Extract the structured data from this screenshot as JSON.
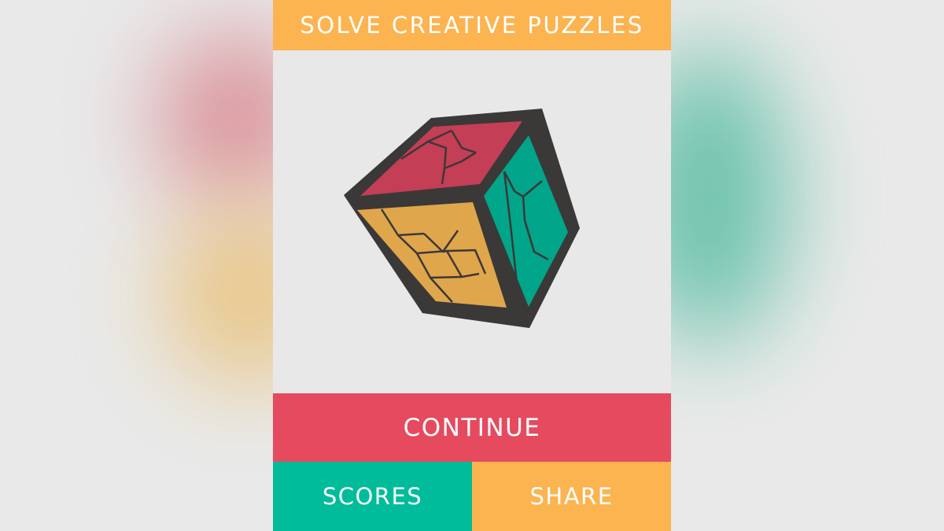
{
  "header": {
    "title": "SOLVE CREATIVE PUZZLES"
  },
  "buttons": {
    "continue_label": "CONTINUE",
    "scores_label": "SCORES",
    "share_label": "SHARE"
  },
  "colors": {
    "yellow": "#fbb450",
    "red": "#e54a5f",
    "teal": "#00bc9a",
    "cube_frame": "#3b3838",
    "panel_bg": "#e8e8e8"
  },
  "icons": {
    "logo": "puzzle-cube-icon"
  }
}
